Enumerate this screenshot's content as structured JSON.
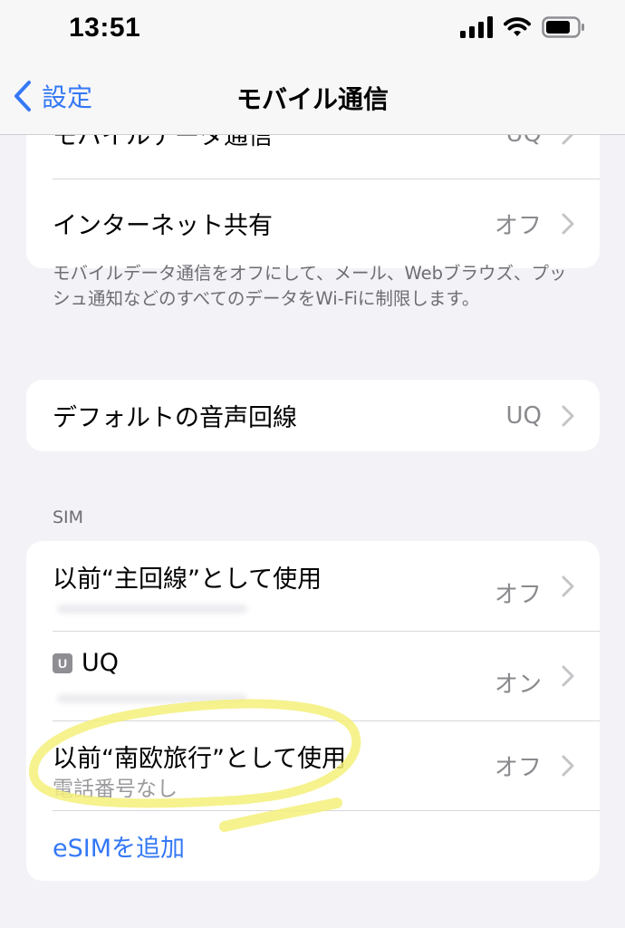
{
  "status_bar": {
    "time": "13:51"
  },
  "nav": {
    "back_label": "設定",
    "title": "モバイル通信"
  },
  "group1": {
    "rows": [
      {
        "label": "モバイルデータ通信",
        "value": "UQ"
      },
      {
        "label": "インターネット共有",
        "value": "オフ"
      }
    ]
  },
  "footnote1": "モバイルデータ通信をオフにして、メール、Webブラウズ、プッシュ通知などのすべてのデータをWi-Fiに制限します。",
  "group2": {
    "rows": [
      {
        "label": "デフォルトの音声回線",
        "value": "UQ"
      }
    ]
  },
  "sim_section": {
    "header": "SIM",
    "rows": [
      {
        "title": "以前“主回線”として使用",
        "value": "オフ"
      },
      {
        "badge": "U",
        "title": "UQ",
        "value": "オン"
      },
      {
        "title": "以前“南欧旅行”として使用",
        "subtitle": "電話番号なし",
        "value": "オフ"
      }
    ],
    "add_esim": "eSIMを追加"
  },
  "colors": {
    "accent": "#3478f6",
    "highlighter": "#f5f07a",
    "background": "#f2f2f7"
  },
  "icons": [
    "signal-icon",
    "wifi-icon",
    "battery-icon",
    "chevron-left-icon",
    "chevron-right-icon"
  ]
}
